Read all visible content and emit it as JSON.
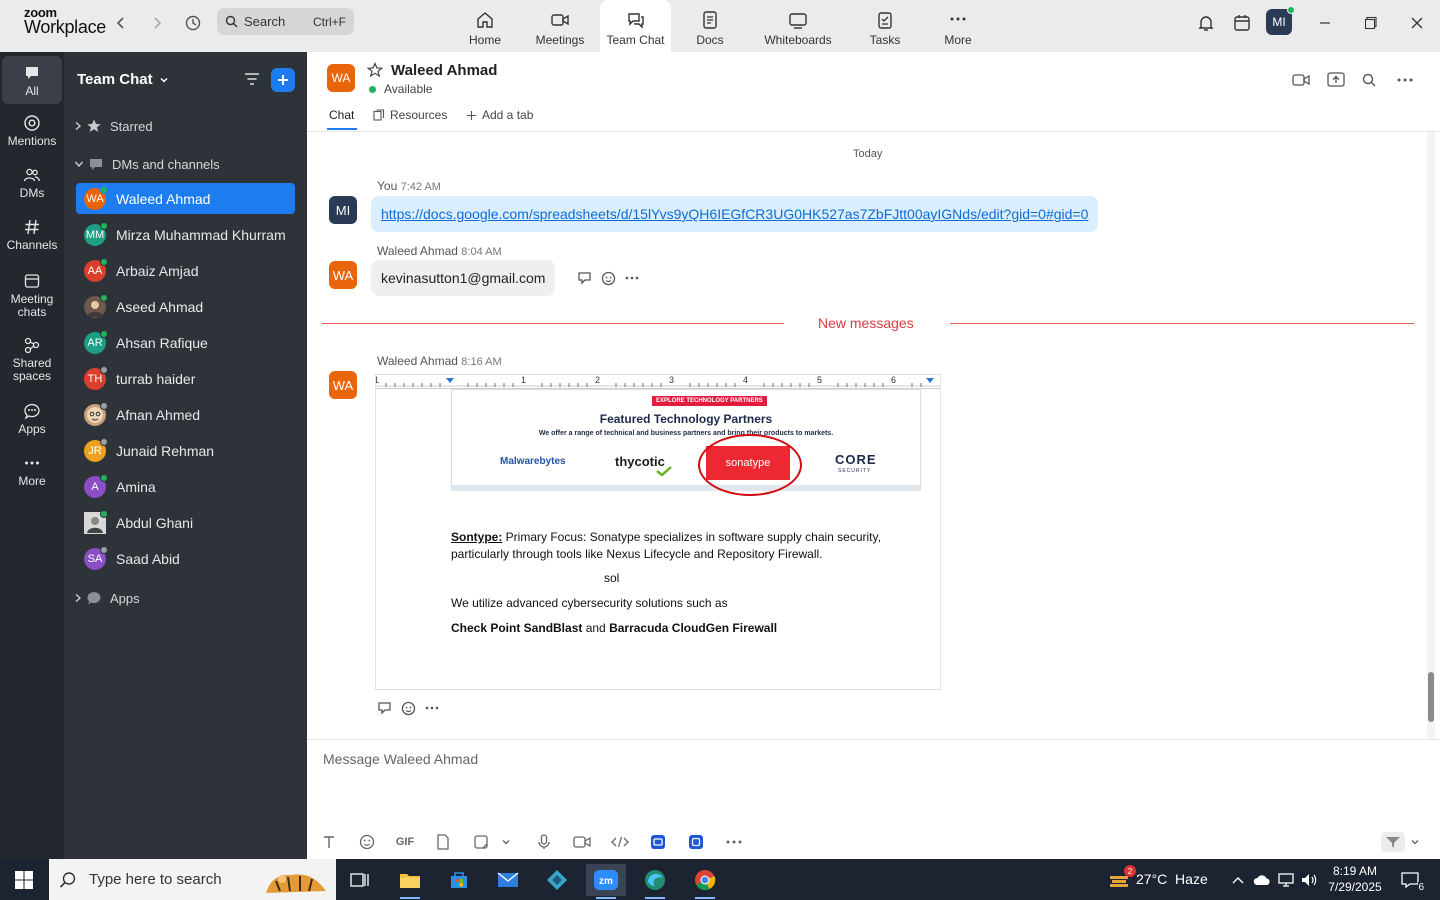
{
  "app": {
    "logo_line1": "zoom",
    "logo_line2": "Workplace"
  },
  "search": {
    "placeholder": "Search",
    "shortcut": "Ctrl+F"
  },
  "nav": [
    {
      "label": "Home"
    },
    {
      "label": "Meetings"
    },
    {
      "label": "Team Chat"
    },
    {
      "label": "Docs"
    },
    {
      "label": "Whiteboards"
    },
    {
      "label": "Tasks"
    },
    {
      "label": "More"
    }
  ],
  "user": {
    "initials": "MI"
  },
  "rail": [
    {
      "label": "All"
    },
    {
      "label": "Mentions"
    },
    {
      "label": "DMs"
    },
    {
      "label": "Channels"
    },
    {
      "label": "Meeting chats"
    },
    {
      "label": "Shared spaces"
    },
    {
      "label": "Apps"
    },
    {
      "label": "More"
    }
  ],
  "sidebar": {
    "title": "Team Chat",
    "starred": "Starred",
    "dms_channels": "DMs and channels",
    "apps": "Apps",
    "contacts": [
      {
        "name": "Waleed Ahmad",
        "initials": "WA",
        "color": "#e8650b",
        "status": "#1fb45a"
      },
      {
        "name": "Mirza Muhammad Khurram",
        "initials": "MM",
        "color": "#1e9e84",
        "status": "#1fb45a"
      },
      {
        "name": "Arbaiz Amjad",
        "initials": "AA",
        "color": "#d9402c",
        "status": "#1fb45a"
      },
      {
        "name": "Aseed Ahmad",
        "initials": "",
        "color": "#6d5a4a",
        "status": "#1fb45a"
      },
      {
        "name": "Ahsan Rafique",
        "initials": "AR",
        "color": "#1e9e84",
        "status": "#1fb45a"
      },
      {
        "name": "turrab haider",
        "initials": "TH",
        "color": "#d9402c",
        "status": "#9aa0a6"
      },
      {
        "name": "Afnan Ahmed",
        "initials": "",
        "color": "#c9a27a",
        "status": "#9aa0a6"
      },
      {
        "name": "Junaid Rehman",
        "initials": "JR",
        "color": "#f0a020",
        "status": "#9aa0a6"
      },
      {
        "name": "Amina",
        "initials": "A",
        "color": "#8a4fc7",
        "status": "#1fb45a"
      },
      {
        "name": "Abdul Ghani",
        "initials": "",
        "color": "#555555",
        "status": "#1fb45a"
      },
      {
        "name": "Saad Abid",
        "initials": "SA",
        "color": "#8a4fc7",
        "status": "#9aa0a6"
      }
    ]
  },
  "chat": {
    "contact_initials": "WA",
    "contact_name": "Waleed Ahmad",
    "status": "Available",
    "tabs": {
      "chat": "Chat",
      "resources": "Resources",
      "add": "Add a tab"
    },
    "date_divider": "Today",
    "new_messages": "New messages",
    "messages": [
      {
        "avatar": "MI",
        "sender": "You",
        "time": "7:42 AM",
        "text": "https://docs.google.com/spreadsheets/d/15lYvs9yQH6IEGfCR3UG0HK527as7ZbFJtt00ayIGNds/edit?gid=0#gid=0"
      },
      {
        "avatar": "WA",
        "sender": "Waleed Ahmad",
        "time": "8:04 AM",
        "text": "kevinasutton1@gmail.com"
      },
      {
        "avatar": "WA",
        "sender": "Waleed Ahmad",
        "time": "8:16 AM"
      }
    ],
    "attachment": {
      "ruler": [
        "1",
        "1",
        "2",
        "3",
        "4",
        "5",
        "6"
      ],
      "badge": "EXPLORE TECHNOLOGY PARTNERS",
      "title": "Featured Technology Partners",
      "subtitle": "We offer a range of technical and business partners and bring their products to markets.",
      "logos": [
        "Malwarebytes",
        "thycotic",
        "sonatype",
        "CORE",
        "SECURITY"
      ],
      "para_label": "Sontype:",
      "para_text": " Primary Focus: Sonatype specializes in software supply chain security, particularly through tools like Nexus Lifecycle and Repository Firewall.",
      "sol": "sol",
      "line1": "We utilize advanced cybersecurity solutions such as",
      "line2_a": "Check Point SandBlast",
      "line2_b": " and ",
      "line2_c": "Barracuda CloudGen Firewall"
    }
  },
  "composer": {
    "placeholder": "Message Waleed Ahmad",
    "gif": "GIF"
  },
  "taskbar": {
    "search_placeholder": "Type here to search",
    "weather_badge": "2",
    "weather": "27°C  Haze",
    "time": "8:19 AM",
    "date": "7/29/2025",
    "notif": "6"
  }
}
